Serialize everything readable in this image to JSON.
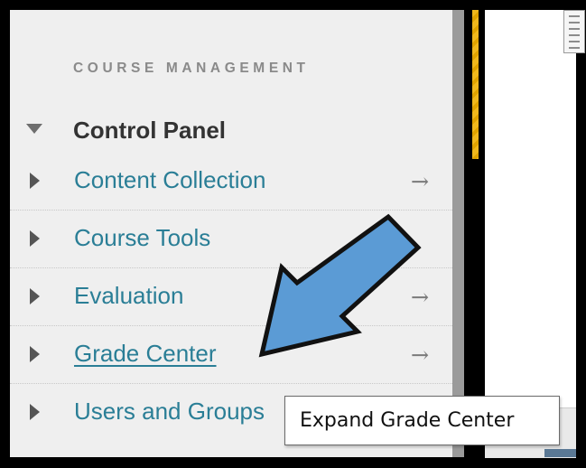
{
  "menu": {
    "section_heading": "COURSE MANAGEMENT",
    "control_panel_label": "Control Panel",
    "control_panel_state": "expanded",
    "items": [
      {
        "label": "Content Collection",
        "arrow": "→"
      },
      {
        "label": "Course Tools",
        "arrow": ""
      },
      {
        "label": "Evaluation",
        "arrow": "→"
      },
      {
        "label": "Grade Center",
        "arrow": "→"
      },
      {
        "label": "Users and Groups",
        "arrow": ""
      }
    ]
  },
  "tooltip": {
    "text": "Expand Grade Center"
  },
  "annotation": {
    "arrow_color": "#5b9bd5",
    "arrow_outline": "#111111",
    "arrow_points_to": "Grade Center"
  },
  "colors": {
    "link": "#2a7e96",
    "heading": "#8a8a8a",
    "panel_bg": "#efefef"
  },
  "icons": [
    "expand-triangle-icon",
    "collapse-triangle-icon",
    "right-arrow-icon",
    "document-icon"
  ]
}
